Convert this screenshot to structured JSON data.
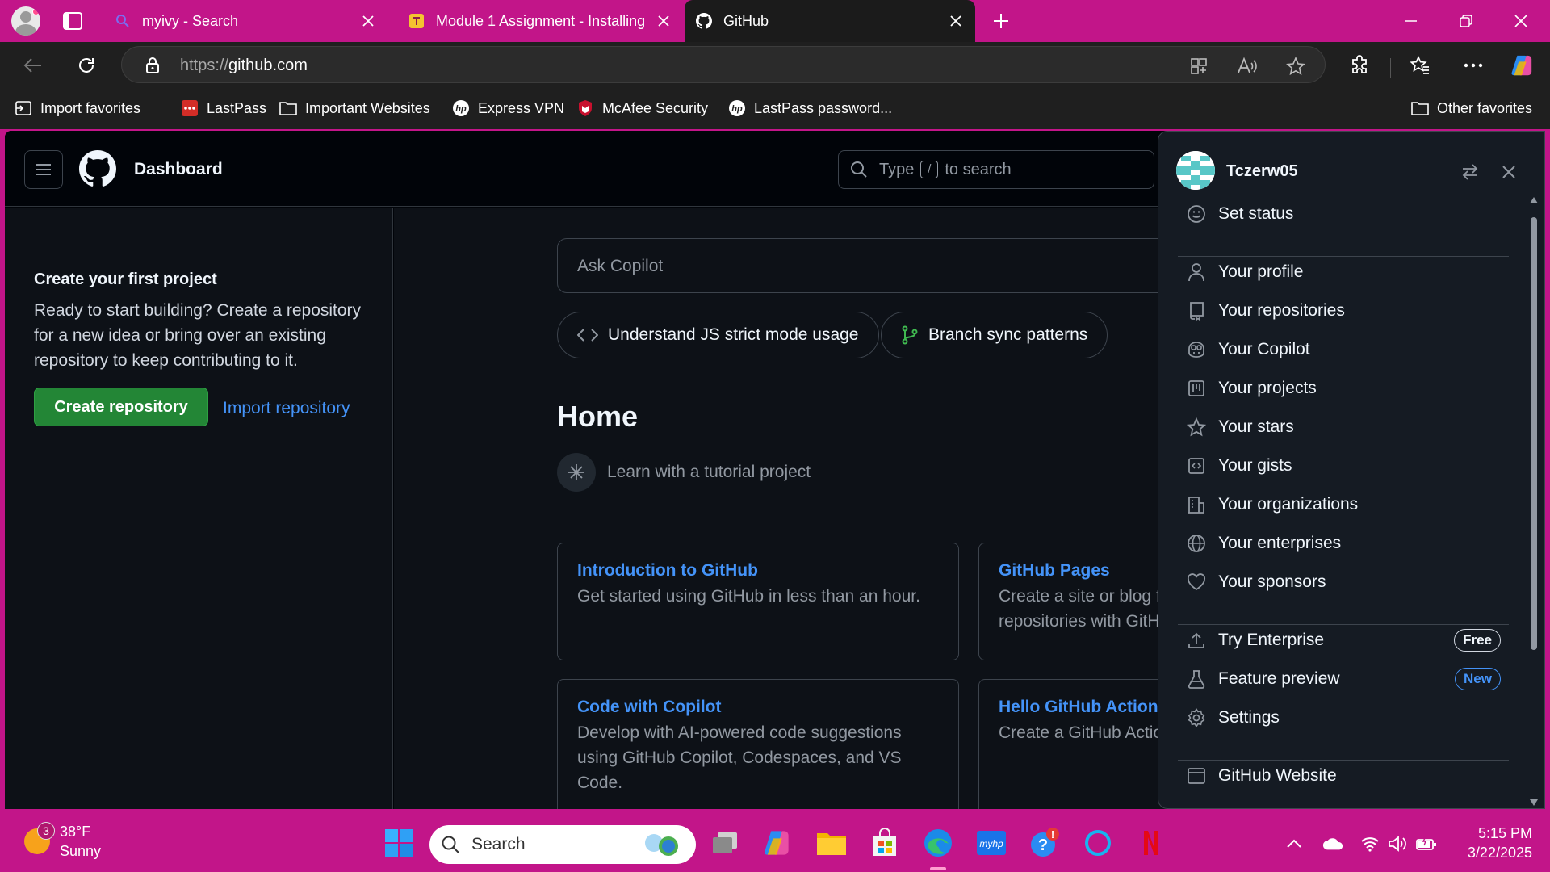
{
  "browser": {
    "tabs": [
      {
        "title": "myivy - Search",
        "active": false
      },
      {
        "title": "Module 1 Assignment - Installing",
        "active": false
      },
      {
        "title": "GitHub",
        "active": true
      }
    ],
    "address": {
      "scheme": "https://",
      "host": "github.com"
    },
    "favorites": [
      {
        "label": "Import favorites",
        "icon": "import-icon"
      },
      {
        "label": "LastPass",
        "icon": "lastpass-icon"
      },
      {
        "label": "Important Websites",
        "icon": "folder-icon"
      },
      {
        "label": "Express VPN",
        "icon": "hp-icon"
      },
      {
        "label": "McAfee Security",
        "icon": "mcafee-icon"
      },
      {
        "label": "LastPass password...",
        "icon": "hp-icon"
      }
    ],
    "other_favorites": "Other favorites"
  },
  "github": {
    "header": {
      "title": "Dashboard",
      "search_placeholder_pre": "Type",
      "search_key": "/",
      "search_placeholder_post": "to search"
    },
    "sidebar": {
      "title": "Create your first project",
      "text": "Ready to start building? Create a repository for a new idea or bring over an existing repository to keep contributing to it.",
      "create_button": "Create repository",
      "import_link": "Import repository"
    },
    "main": {
      "ask_placeholder": "Ask Copilot",
      "chips": [
        {
          "label": "Understand JS strict mode usage",
          "icon": "code-icon"
        },
        {
          "label": "Branch sync patterns",
          "icon": "git-branch-icon"
        }
      ],
      "home_title": "Home",
      "learn_label": "Learn with a tutorial project",
      "cards": [
        {
          "title": "Introduction to GitHub",
          "desc": "Get started using GitHub in less than an hour."
        },
        {
          "title": "GitHub Pages",
          "desc": "Create a site or blog from your GitHub repositories with GitHub Pages."
        },
        {
          "title": "Code with Copilot",
          "desc": "Develop with AI-powered code suggestions using GitHub Copilot, Codespaces, and VS Code."
        },
        {
          "title": "Hello GitHub Actions",
          "desc": "Create a GitHub Action and use it in a workflow."
        }
      ]
    },
    "user_panel": {
      "username": "Tczerw05",
      "items": [
        {
          "label": "Set status",
          "icon": "smiley-icon"
        },
        {
          "label": "Your profile",
          "icon": "person-icon"
        },
        {
          "label": "Your repositories",
          "icon": "repo-icon"
        },
        {
          "label": "Your Copilot",
          "icon": "copilot-icon"
        },
        {
          "label": "Your projects",
          "icon": "table-icon"
        },
        {
          "label": "Your stars",
          "icon": "star-icon"
        },
        {
          "label": "Your gists",
          "icon": "code-square-icon"
        },
        {
          "label": "Your organizations",
          "icon": "organization-icon"
        },
        {
          "label": "Your enterprises",
          "icon": "globe-icon"
        },
        {
          "label": "Your sponsors",
          "icon": "heart-icon"
        },
        {
          "label": "Try Enterprise",
          "icon": "upload-icon",
          "badge": "Free"
        },
        {
          "label": "Feature preview",
          "icon": "beaker-icon",
          "badge": "New"
        },
        {
          "label": "Settings",
          "icon": "gear-icon"
        },
        {
          "label": "GitHub Website",
          "icon": "browser-icon"
        }
      ]
    }
  },
  "taskbar": {
    "weather": {
      "temp": "38°F",
      "condition": "Sunny",
      "badge": "3"
    },
    "search_label": "Search",
    "time": "5:15 PM",
    "date": "3/22/2025"
  },
  "colors": {
    "edge_accent": "#c21589",
    "github_bg": "#0d1117",
    "github_link": "#4493f8",
    "create_button": "#238636"
  }
}
